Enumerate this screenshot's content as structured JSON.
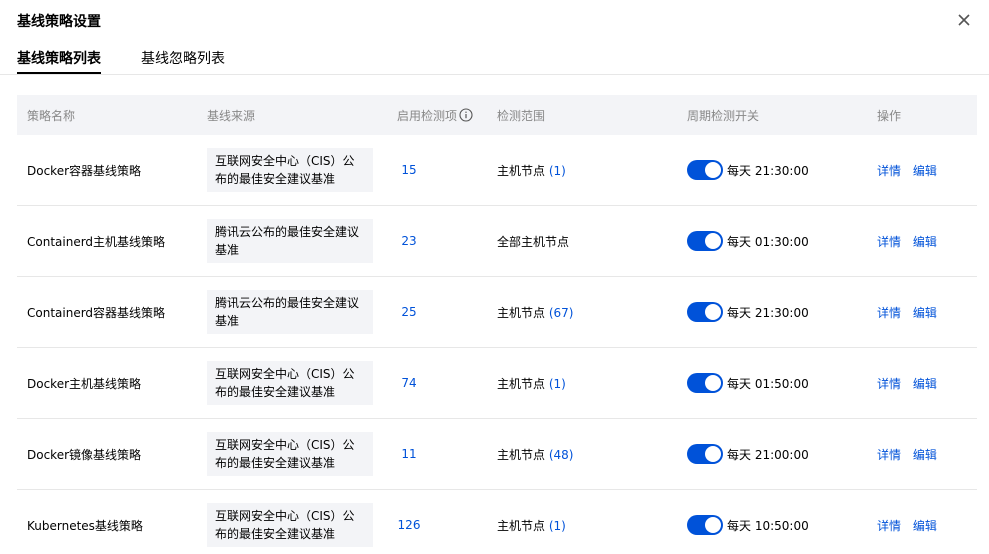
{
  "dialog": {
    "title": "基线策略设置"
  },
  "tabs": [
    {
      "label": "基线策略列表",
      "active": true
    },
    {
      "label": "基线忽略列表",
      "active": false
    }
  ],
  "table": {
    "headers": {
      "name": "策略名称",
      "source": "基线来源",
      "enabled_items": "启用检测项",
      "scope": "检测范围",
      "cycle": "周期检测开关",
      "actions": "操作"
    },
    "rows": [
      {
        "name": "Docker容器基线策略",
        "source": "互联网安全中心（CIS）公布的最佳安全建议基准",
        "count": "15",
        "scope_label": "主机节点",
        "scope_count": "(1)",
        "switch_on": true,
        "cycle_text": "每天 21:30:00",
        "detail": "详情",
        "edit": "编辑"
      },
      {
        "name": "Containerd主机基线策略",
        "source": "腾讯云公布的最佳安全建议基准",
        "count": "23",
        "scope_label": "全部主机节点",
        "scope_count": "",
        "switch_on": true,
        "cycle_text": "每天 01:30:00",
        "detail": "详情",
        "edit": "编辑"
      },
      {
        "name": "Containerd容器基线策略",
        "source": "腾讯云公布的最佳安全建议基准",
        "count": "25",
        "scope_label": "主机节点",
        "scope_count": "(67)",
        "switch_on": true,
        "cycle_text": "每天 21:30:00",
        "detail": "详情",
        "edit": "编辑"
      },
      {
        "name": "Docker主机基线策略",
        "source": "互联网安全中心（CIS）公布的最佳安全建议基准",
        "count": "74",
        "scope_label": "主机节点",
        "scope_count": "(1)",
        "switch_on": true,
        "cycle_text": "每天 01:50:00",
        "detail": "详情",
        "edit": "编辑"
      },
      {
        "name": "Docker镜像基线策略",
        "source": "互联网安全中心（CIS）公布的最佳安全建议基准",
        "count": "11",
        "scope_label": "主机节点",
        "scope_count": "(48)",
        "switch_on": true,
        "cycle_text": "每天 21:00:00",
        "detail": "详情",
        "edit": "编辑"
      },
      {
        "name": "Kubernetes基线策略",
        "source": "互联网安全中心（CIS）公布的最佳安全建议基准",
        "count": "126",
        "scope_label": "主机节点",
        "scope_count": "(1)",
        "switch_on": true,
        "cycle_text": "每天 10:50:00",
        "detail": "详情",
        "edit": "编辑"
      }
    ]
  },
  "icons": {
    "close": "close-icon",
    "info": "info-circle-icon"
  },
  "colors": {
    "link": "#0052d9",
    "switch_on": "#0052d9",
    "header_bg": "#f3f4f7"
  }
}
